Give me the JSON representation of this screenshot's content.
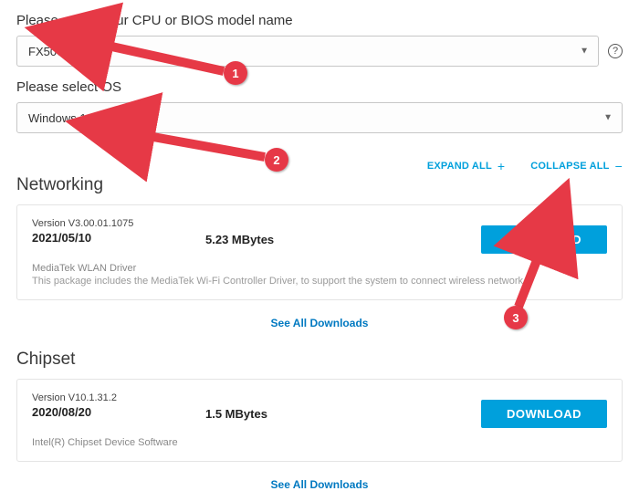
{
  "selectors": {
    "cpu_bios_label": "Please select your CPU or BIOS model name",
    "cpu_bios_value": "FX506LH",
    "os_label": "Please select OS",
    "os_value": "Windows 10 64-bit"
  },
  "actions": {
    "expand_all": "EXPAND ALL",
    "collapse_all": "COLLAPSE ALL"
  },
  "sections": {
    "networking": {
      "title": "Networking",
      "version": "Version V3.00.01.1075",
      "date": "2021/05/10",
      "size": "5.23 MBytes",
      "download": "DOWNLOAD",
      "driver_name": "MediaTek WLAN Driver",
      "driver_desc": "This package includes the MediaTek Wi-Fi Controller Driver, to support the system to connect wireless network.",
      "see_all": "See All Downloads"
    },
    "chipset": {
      "title": "Chipset",
      "version": "Version V10.1.31.2",
      "date": "2020/08/20",
      "size": "1.5 MBytes",
      "download": "DOWNLOAD",
      "driver_name": "Intel(R) Chipset Device Software",
      "see_all": "See All Downloads"
    }
  },
  "annotations": {
    "badge1": "1",
    "badge2": "2",
    "badge3": "3"
  }
}
